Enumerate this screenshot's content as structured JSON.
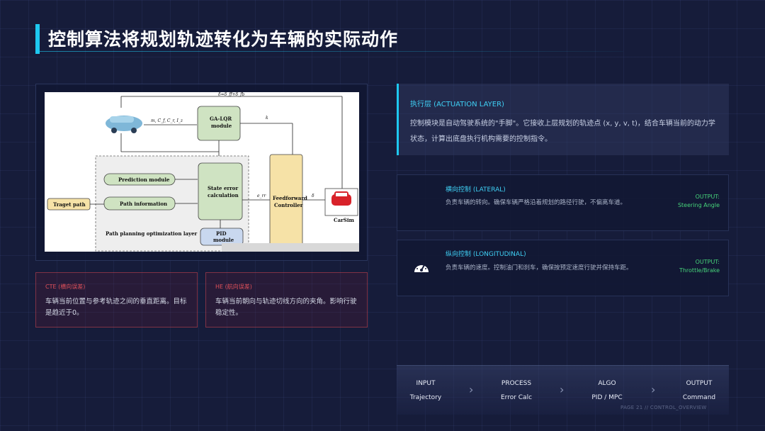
{
  "header": {
    "title": "控制算法将规划轨迹转化为车辆的实际动作"
  },
  "diagram": {
    "labels": {
      "feedback": "δ=δ_ff+δ_fb",
      "params": "m, C_f, C_r, I_z",
      "galqr": "GA-LQR",
      "galqr_sub": "module",
      "k": "k",
      "prediction": "Prediction module",
      "state_error": "State error",
      "state_error_sub": "calculation",
      "feedforward": "Feedforward",
      "feedforward_sub": "Controller",
      "path_info": "Path information",
      "target_path": "Traget path",
      "e_rr": "e_rr",
      "delta": "δ",
      "carsim": "CarSim",
      "planning_layer": "Path planning optimization layer",
      "pid": "PID",
      "pid_sub": "module"
    }
  },
  "cards": {
    "cte": {
      "title": "CTE (横向误差)",
      "body": "车辆当前位置与参考轨迹之间的垂直距离。目标是趋近于0。"
    },
    "he": {
      "title": "HE (航向误差)",
      "body": "车辆当前朝向与轨迹切线方向的夹角。影响行驶稳定性。"
    }
  },
  "actuation": {
    "title": "执行层 (ACTUATION LAYER)",
    "body": "控制模块是自动驾驶系统的\"手脚\"。它接收上层规划的轨迹点 (x, y, v, t)，结合车辆当前的动力学状态，计算出底盘执行机构需要的控制指令。"
  },
  "lateral": {
    "title": "横向控制 (LATERAL)",
    "desc": "负责车辆的转向。确保车辆严格沿着规划的路径行驶，不偏离车道。",
    "out_label": "OUTPUT:",
    "out_value": "Steering Angle"
  },
  "longitudinal": {
    "title": "纵向控制 (LONGITUDINAL)",
    "desc": "负责车辆的速度。控制油门和刹车，确保按预定速度行驶并保持车距。",
    "out_label": "OUTPUT:",
    "out_value": "Throttle/Brake",
    "icon": "gauge-icon"
  },
  "pipeline": {
    "steps": [
      {
        "top": "INPUT",
        "bottom": "Trajectory"
      },
      {
        "top": "PROCESS",
        "bottom": "Error Calc"
      },
      {
        "top": "ALGO",
        "bottom": "PID / MPC"
      },
      {
        "top": "OUTPUT",
        "bottom": "Command"
      }
    ],
    "chevron": "›",
    "footer": "PAGE 21 // CONTROL_OVERVIEW"
  },
  "colors": {
    "accent": "#1ec8f0",
    "output_green": "#46d47a",
    "error_red": "#e0505a",
    "background": "#161c3a"
  }
}
